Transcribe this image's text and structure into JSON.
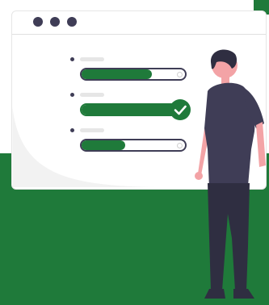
{
  "colors": {
    "accent_green": "#1f7a3a",
    "dark": "#3f3d56",
    "skin": "#f3a3a6",
    "light_gray": "#e6e6e6"
  },
  "window": {
    "control_icons": [
      "dot-icon",
      "dot-icon",
      "dot-icon"
    ]
  },
  "progress_items": [
    {
      "progress": 0.68,
      "complete": false
    },
    {
      "progress": 1.0,
      "complete": true,
      "icon": "checkmark-icon"
    },
    {
      "progress": 0.42,
      "complete": false
    }
  ],
  "figure": {
    "icon": "standing-person-illustration"
  }
}
